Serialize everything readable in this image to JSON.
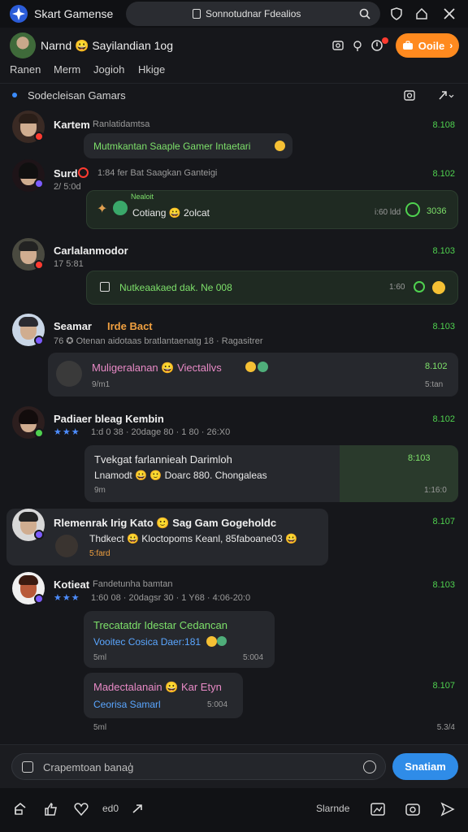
{
  "top_bar": {
    "app_title": "Skart Gamense",
    "search_text": "Sonnotudnar Fdealios"
  },
  "profile": {
    "name": "Narnd 😀 Sayilandian 1og",
    "action_button": "Ooile"
  },
  "nav": [
    "Ranen",
    "Merm",
    "Jogioh",
    "Hkige"
  ],
  "section": {
    "title": "Sodecleisan Gamars"
  },
  "messages": [
    {
      "name": "Kartem",
      "meta": "Ranlatidamtsa",
      "time": "8.108",
      "bubble_line1": "Mutmkantan Saaple Gamer Intaetari"
    },
    {
      "name": "Surd",
      "meta": "1:84 fer Bat Saagkan Ganteigi",
      "submeta": "2/ 5:0d",
      "time": "8.102",
      "bubble_tag": "Nealoit",
      "bubble_line1": "Cotiang 😀 2olcat",
      "bubble_right": "i:60 ldd",
      "bubble_right2": "3036"
    },
    {
      "name": "Carlalanmodor",
      "submeta": "17 5:81",
      "time": "8.103",
      "bubble_line1": "Nutkeaakaed dak. Ne 008",
      "bubble_right": "1:60"
    },
    {
      "name": "Seamar",
      "name_accent": "Irde Bact",
      "meta": "76 ✪ Otenan aidotaas bratlantaenatg 18 · Ragasitrer",
      "time": "8.103",
      "bubble_line1": "Muligeralanan 😀 Viectallvs",
      "bubble_sub": "9/m1",
      "bubble_right": "8.102",
      "bubble_right2": "5:tan"
    },
    {
      "name": "Padiaer bleag Kembin",
      "meta": "1:d 0 38 · 20dage 80 · 1 80 · 26:X0",
      "time": "8.102",
      "bubble_line1": "Tvekgat farlannieah Darimloh",
      "bubble_line2": "Lnamodt 😀 🙂 Doarc 880. Chongaleas",
      "bubble_sub": "9m",
      "bubble_right": "8:103",
      "bubble_right2": "1:16:0"
    },
    {
      "name": "Rlemenrak Irig Kato 🙂 Sag Gam Gogeholdc",
      "bubble_line1": "Thdkect 😀 Kloctopoms Keanl, 85faboane03 😀",
      "bubble_sub": "5:fard",
      "time": "8.107"
    },
    {
      "name": "Kotieat",
      "meta": "Fandetunha bamtan",
      "submeta": "1:60 08 · 20dagsr 30 · 1 Y68 · 4:06-20:0",
      "time": "8.103",
      "bubble_line1": "Trecatatdr Idestar Cedancan",
      "bubble_line2": "Vooitec Cosica Daer:181",
      "bubble_sub": "5ml",
      "bubble_right": "5:004"
    },
    {
      "name": "Madectalanain 😀 Kar Etyn",
      "bubble_line2": "Ceorisa Samarl",
      "bubble_right": "5:004",
      "bubble_sub": "5ml",
      "time": "8.107",
      "time2": "5.3/4"
    }
  ],
  "composer": {
    "placeholder": "Crapemtoan banaģ",
    "send_label": "Snatiam"
  },
  "bottom_bar": {
    "count": "ed0",
    "label": "Slarnde"
  },
  "colors": {
    "accent_orange": "#ff8a1f",
    "accent_blue": "#2f8ce8",
    "time_green": "#4fd14f"
  }
}
